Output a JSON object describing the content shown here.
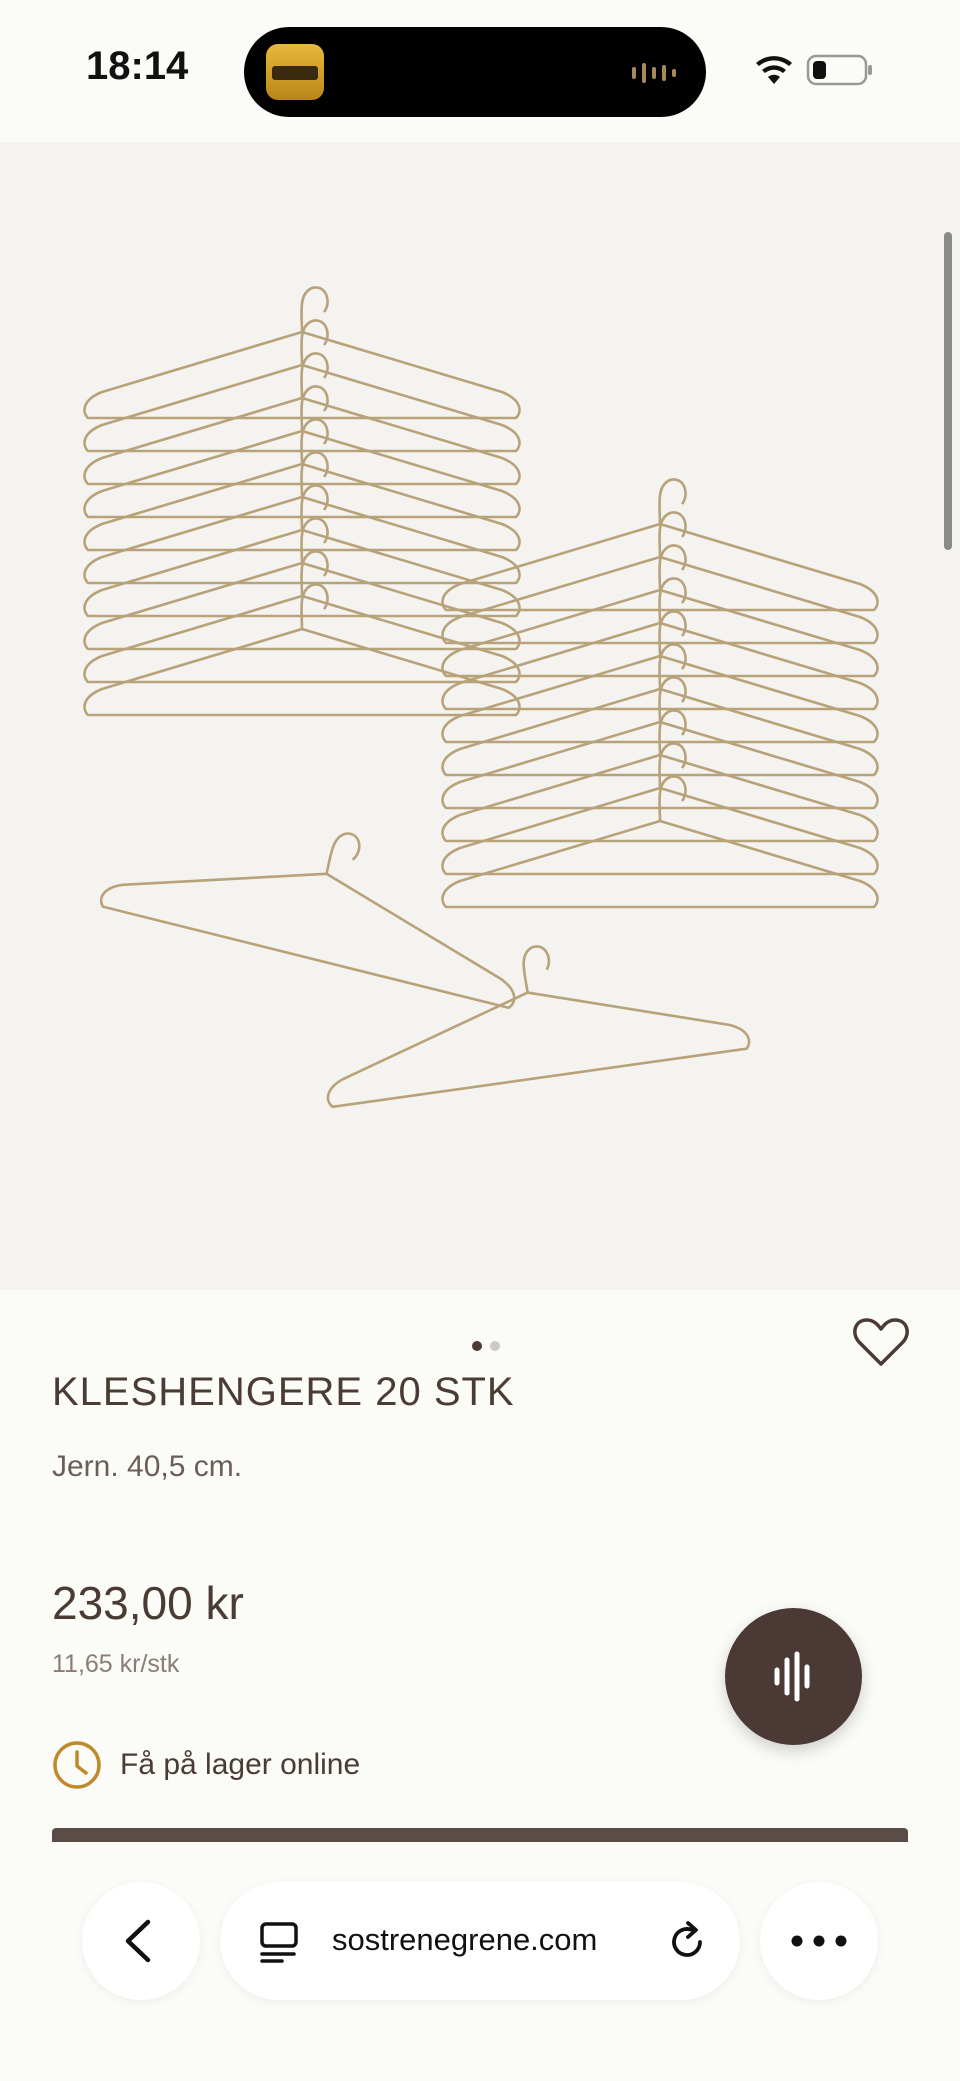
{
  "status_bar": {
    "time": "18:14"
  },
  "product": {
    "title": "KLESHENGERE 20 STK",
    "description": "Jern. 40,5 cm.",
    "price": "233,00 kr",
    "unit_price": "11,65 kr/stk",
    "stock_label": "Få på lager online",
    "image_pager": {
      "count": 2,
      "active": 1
    }
  },
  "browser": {
    "url": "sostrenegrene.com"
  },
  "colors": {
    "background": "#fbfbf7",
    "text_primary": "#4a3b35",
    "accent_clock": "#c08a2a",
    "fab": "#4a3935",
    "hanger_gold": "#b7a27a"
  },
  "icons": {
    "status": [
      "wifi-icon",
      "battery-icon"
    ],
    "product": [
      "heart-icon",
      "clock-icon",
      "voice-icon"
    ],
    "browser": [
      "back-icon",
      "tabs-icon",
      "reload-icon",
      "more-icon"
    ]
  }
}
